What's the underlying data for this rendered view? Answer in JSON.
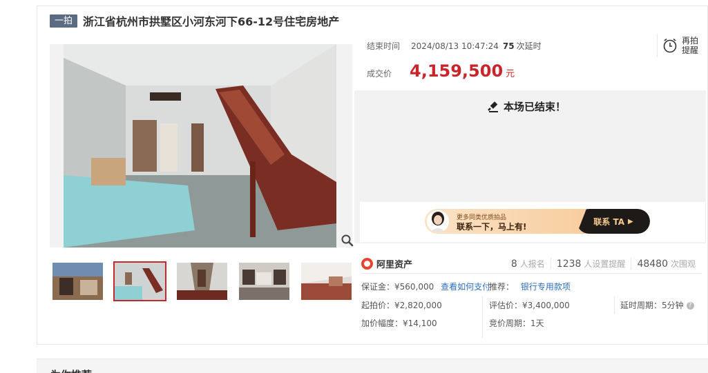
{
  "listing": {
    "tag": "一拍",
    "title": "浙江省杭州市拱墅区小河东河下66-12号住宅房地产"
  },
  "auction": {
    "end_label": "结束时间",
    "end_time": "2024/08/13 10:47:24",
    "delay_count": "75",
    "delay_label": "次延时",
    "deal_label": "成交价",
    "deal_price": "4,159,500",
    "deal_unit": "元",
    "status": "本场已结束！"
  },
  "remind": {
    "label": "再拍提醒"
  },
  "banner": {
    "sub": "更多同类优质拍品",
    "main": "联系一下，马上有!",
    "cta": "联系 TA",
    "cta_arrow": "▶"
  },
  "stats": {
    "brand": "阿里资产",
    "signups": "8",
    "signups_label": "人报名",
    "reminders": "1238",
    "reminders_label": "人设置提醒",
    "views": "48480",
    "views_label": "次围观"
  },
  "details": {
    "deposit_label": "保证金：",
    "deposit_value": "¥560,000",
    "how_to_pay": "查看如何支付",
    "recommend_label": "推荐：",
    "recommend_value": "银行专用款项",
    "start_price": "起拍价：¥2,820,000",
    "appraisal": "评估价：¥3,400,000",
    "delay_period": "延时周期：5分钟",
    "help": "?",
    "increment": "加价幅度：¥14,100",
    "bid_period": "竞价周期：1天"
  },
  "recommend_section": {
    "title": "为你推荐"
  },
  "colors": {
    "accent_red": "#c9262b",
    "tag_bg": "#5b6b82",
    "link": "#2a6ebb"
  },
  "icons": [
    "search-zoom-icon",
    "alarm-clock-icon",
    "gavel-icon",
    "aliasset-logo-icon"
  ]
}
